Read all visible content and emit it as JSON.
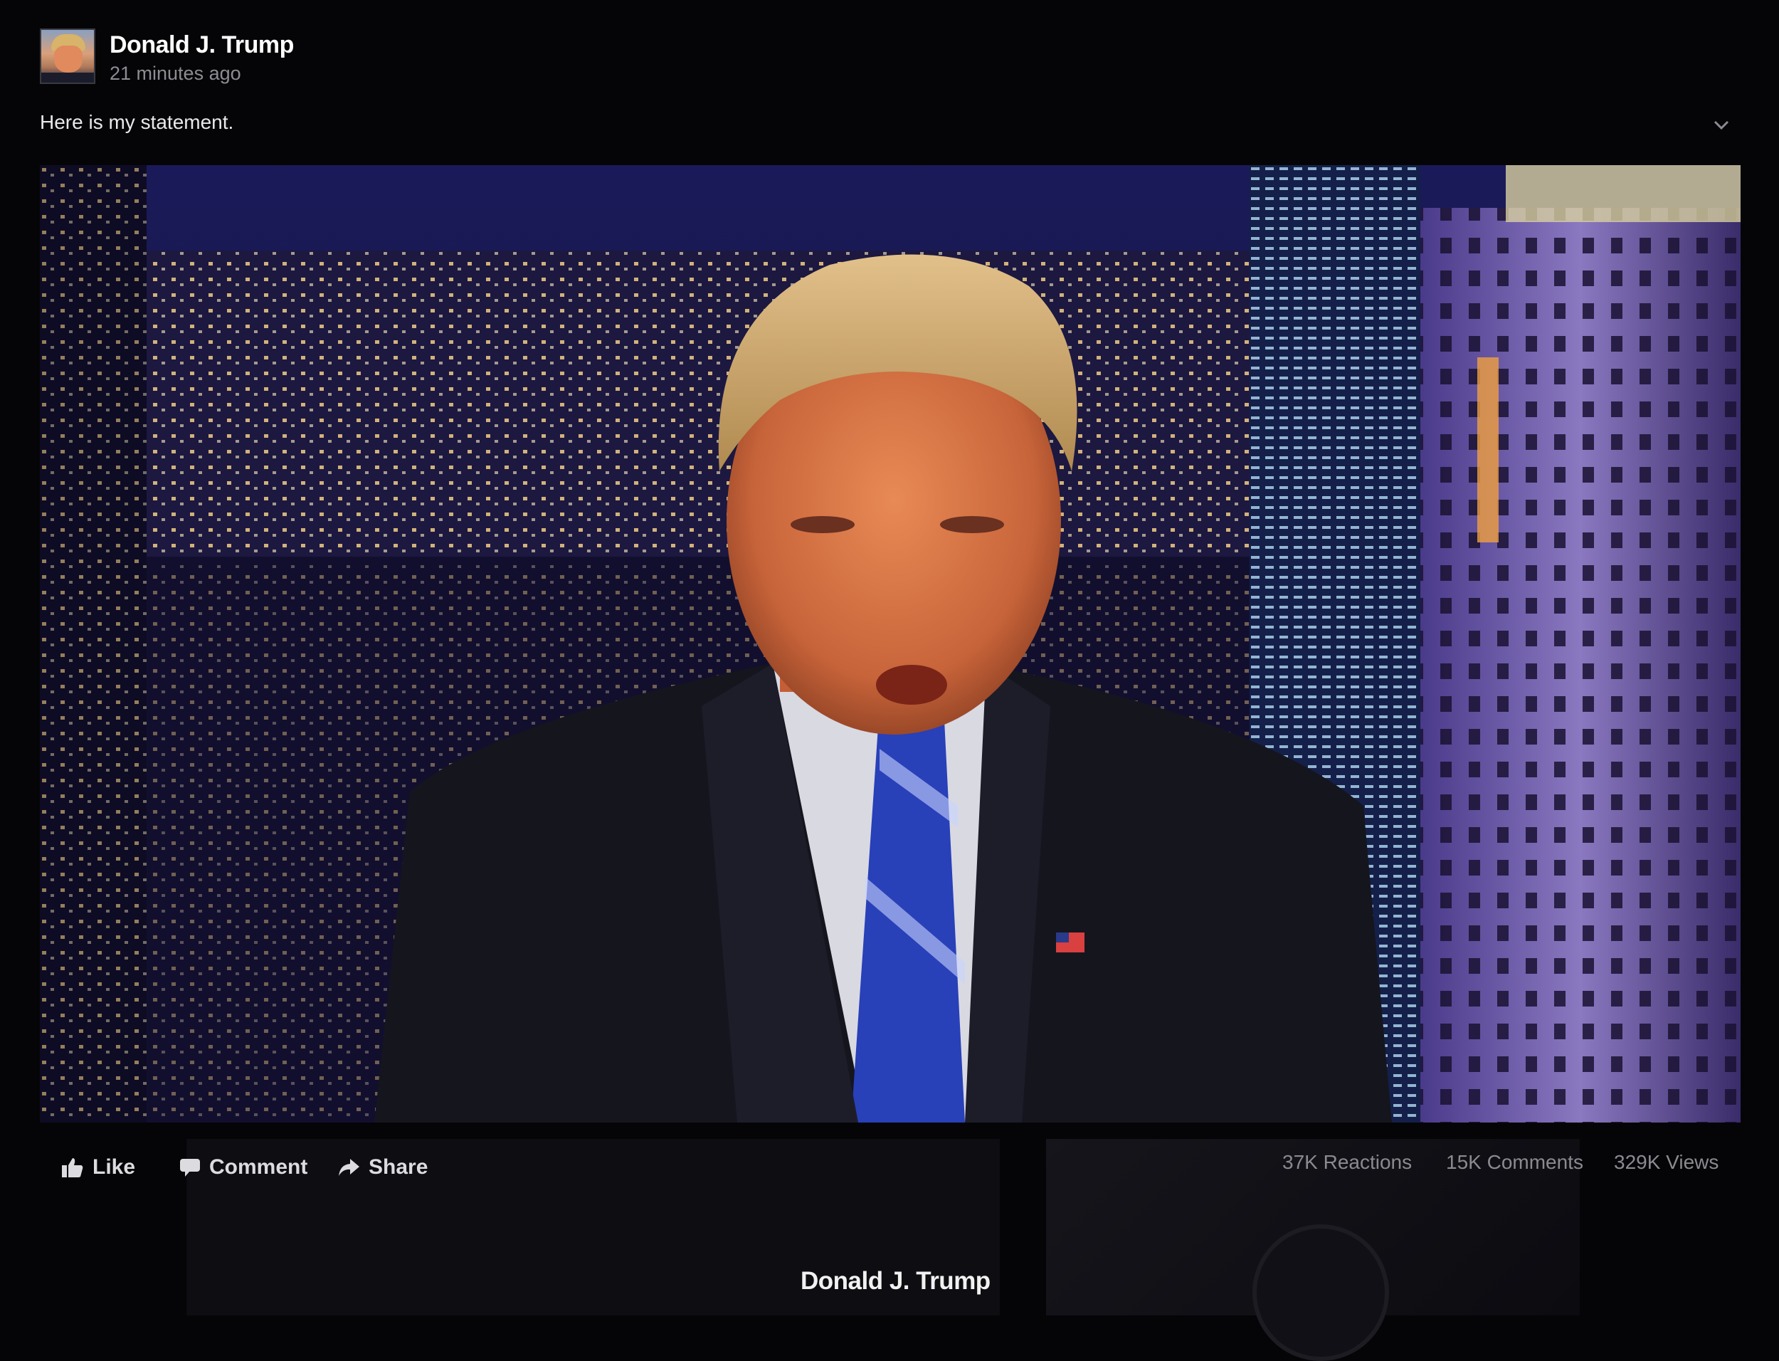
{
  "post": {
    "author": "Donald J. Trump",
    "time": "21 minutes ago",
    "text": "Here is my statement."
  },
  "actions": {
    "like": "Like",
    "comment": "Comment",
    "share": "Share"
  },
  "stats": {
    "reactions": "37K Reactions",
    "comments": "15K Comments",
    "views": "329K Views"
  },
  "background": {
    "author": "Donald J. Trump"
  },
  "icons": {
    "like": "thumbs-up-icon",
    "comment": "speech-bubble-icon",
    "share": "share-arrow-icon",
    "menu": "chevron-down-icon"
  }
}
